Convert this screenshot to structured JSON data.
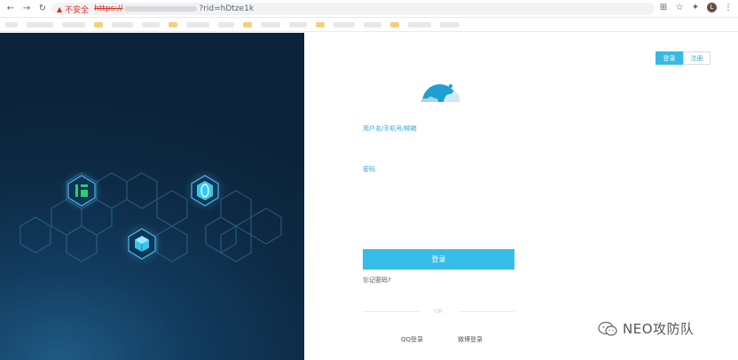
{
  "browser": {
    "insecure_label": "不安全",
    "url_scheme": "https://",
    "url_path": "?rid=hDtze1k",
    "avatar_letter": "L"
  },
  "tabs": {
    "login": "登录",
    "register": "注册"
  },
  "form": {
    "username_label": "用户名/手机号/邮箱",
    "password_label": "密码",
    "login_button": "登录",
    "forgot_link": "忘记密码?",
    "or_text": "OR"
  },
  "third_party": {
    "qq": "QQ登录",
    "weibo": "微博登录"
  },
  "watermark": {
    "text": "NEO攻防队"
  },
  "colors": {
    "accent": "#36b9e6",
    "panel_dark": "#0d2a45"
  }
}
